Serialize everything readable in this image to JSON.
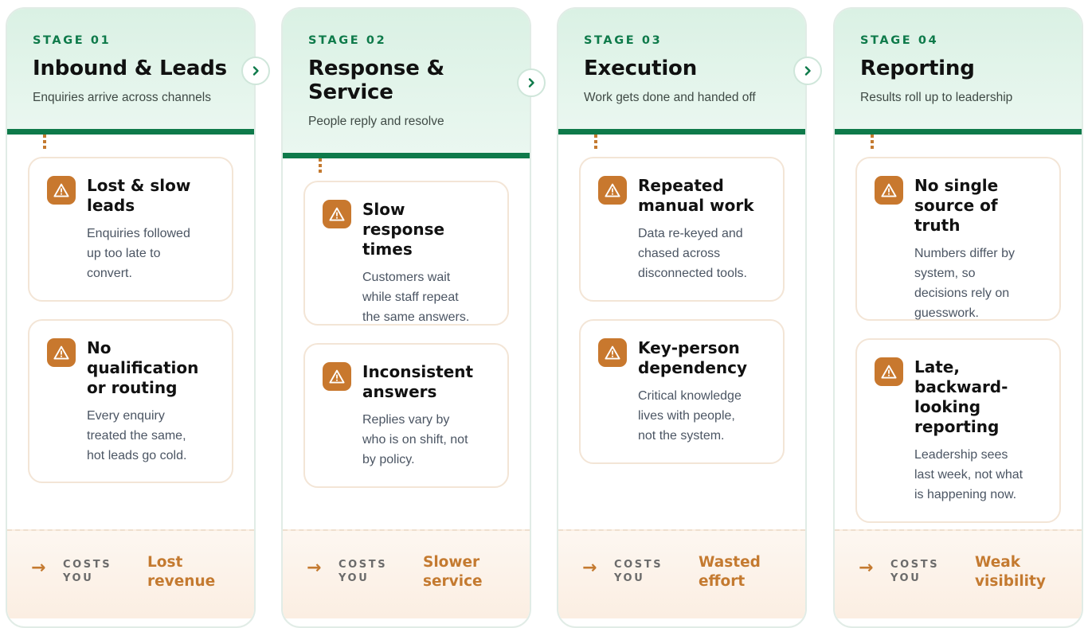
{
  "stages": [
    {
      "label": "STAGE 01",
      "title": "Inbound & Leads",
      "subtitle": "Enquiries arrive across channels",
      "cards": [
        {
          "title": "Lost & slow\nleads",
          "body": "Enquiries followed\nup too late to\nconvert."
        },
        {
          "title": "No\nqualification\nor routing",
          "body": "Every enquiry\ntreated the same,\nhot leads go cold."
        }
      ],
      "costs_label": "COSTS\nYOU",
      "cost_value": "Lost\nrevenue"
    },
    {
      "label": "STAGE 02",
      "title": "Response &\nService",
      "subtitle": "People reply and resolve",
      "cards": [
        {
          "title": "Slow response\ntimes",
          "body": "Customers wait\nwhile staff repeat\nthe same answers."
        },
        {
          "title": "Inconsistent\nanswers",
          "body": "Replies vary by\nwho is on shift, not\nby policy."
        }
      ],
      "costs_label": "COSTS\nYOU",
      "cost_value": "Slower\nservice"
    },
    {
      "label": "STAGE 03",
      "title": "Execution",
      "subtitle": "Work gets done and handed off",
      "cards": [
        {
          "title": "Repeated\nmanual work",
          "body": "Data re-keyed and\nchased across\ndisconnected tools."
        },
        {
          "title": "Key-person\ndependency",
          "body": "Critical knowledge\nlives with people,\nnot the system."
        }
      ],
      "costs_label": "COSTS\nYOU",
      "cost_value": "Wasted\neffort"
    },
    {
      "label": "STAGE 04",
      "title": "Reporting",
      "subtitle": "Results roll up to leadership",
      "cards": [
        {
          "title": "No single\nsource of truth",
          "body": "Numbers differ by\nsystem, so\ndecisions rely on\nguesswork."
        },
        {
          "title": "Late,\nbackward-\nlooking\nreporting",
          "body": "Leadership sees\nlast week, not what\nis happening now."
        }
      ],
      "costs_label": "COSTS\nYOU",
      "cost_value": "Weak\nvisibility"
    }
  ],
  "icons": {
    "card": "warning-icon",
    "connector": "chevron-right-icon",
    "footer": "arrow-right-icon"
  },
  "colors": {
    "accent_green": "#0e7a4a",
    "accent_orange": "#c8782e"
  }
}
